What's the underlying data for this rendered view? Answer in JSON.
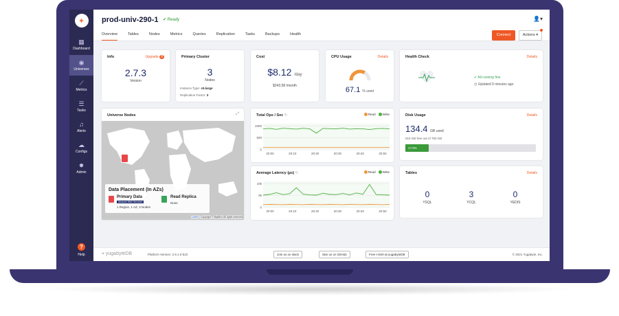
{
  "app": {
    "title": "prod-univ-290-1",
    "status": "Ready"
  },
  "sidebar": {
    "items": [
      {
        "label": "Dashboard",
        "icon": "dashboard-icon"
      },
      {
        "label": "Universes",
        "icon": "globe-icon"
      },
      {
        "label": "Metrics",
        "icon": "chart-icon"
      },
      {
        "label": "Tasks",
        "icon": "list-icon"
      },
      {
        "label": "Alerts",
        "icon": "bell-icon"
      },
      {
        "label": "Configs",
        "icon": "cloud-icon"
      },
      {
        "label": "Admin",
        "icon": "gear-icon"
      }
    ],
    "help": "Help"
  },
  "tabs": [
    "Overview",
    "Tables",
    "Nodes",
    "Metrics",
    "Queries",
    "Replication",
    "Tasks",
    "Backups",
    "Health"
  ],
  "header": {
    "connect": "Connect",
    "actions": "Actions"
  },
  "info": {
    "title": "Info",
    "upgrade": "Upgrade",
    "badge": "8",
    "version": "2.7.3",
    "version_label": "Version"
  },
  "primary": {
    "title": "Primary Cluster",
    "nodes": "3",
    "nodes_label": "Nodes",
    "instance_label": "Instance Type:",
    "instance": "c5.large",
    "rf_label": "Replication Factor:",
    "rf": "3"
  },
  "cost": {
    "title": "Cost",
    "per_day": "$8.12",
    "day_unit": "/day",
    "per_month": "$243.58 /month"
  },
  "cpu": {
    "title": "CPU Usage",
    "details": "Details",
    "value": "67.1",
    "unit": "% used",
    "fraction": 0.671
  },
  "health": {
    "title": "Health Check",
    "details": "Details",
    "status": "All running fine",
    "updated": "Updated 9 minutes ago"
  },
  "map": {
    "title": "Universe Nodes",
    "placement": "Data Placement (In AZs)",
    "primary": "Primary Data",
    "provider": "Amazon Web Services",
    "primary_detail": "1 Region, 1 AZ, 3 Nodes",
    "replica": "Read Replica",
    "replica_detail": "None",
    "credit_leaflet": "Leaflet",
    "credit": "| Copyright © MapBox All rights reserved"
  },
  "ops": {
    "title": "Total Ops / Sec",
    "legend_read": "Read",
    "legend_write": "Write",
    "y_ticks": [
      "1000",
      "500",
      "0"
    ],
    "x_ticks": [
      "20:00",
      "20:10",
      "20:20",
      "20:30",
      "20:40",
      "20:50"
    ]
  },
  "latency": {
    "title": "Average Latency (µs)",
    "legend_read": "Read",
    "legend_write": "Write",
    "y_ticks": [
      "10k",
      "5k",
      "0"
    ],
    "x_ticks": [
      "20:00",
      "20:10",
      "20:20",
      "20:30",
      "20:40",
      "20:50"
    ]
  },
  "disk": {
    "title": "Disk Usage",
    "details": "Details",
    "used": "134.4",
    "unit": "GB used",
    "free": "615 GB free out of 750 GB",
    "pct_label": "17.9%",
    "fraction": 0.179
  },
  "tables": {
    "title": "Tables",
    "details": "Details",
    "items": [
      {
        "count": "0",
        "label": "YSQL"
      },
      {
        "count": "3",
        "label": "YCQL"
      },
      {
        "count": "0",
        "label": "YEDIS"
      }
    ]
  },
  "footer": {
    "brand": "yugabyteDB",
    "version": "Platform Version: 2.9.1.0-b22",
    "slack": "Join us on  slack",
    "github": "Star us on  GitHub",
    "tshirt": "Free t-shirt at  yugabyteDB",
    "copyright": "© 2021 Yugabyte, Inc."
  },
  "colors": {
    "accent": "#ef5824",
    "read": "#f0953a",
    "write": "#4caf3f",
    "sidebar": "#2b2a52"
  },
  "chart_data": [
    {
      "type": "line",
      "title": "Total Ops / Sec",
      "series": [
        {
          "name": "Read",
          "values": [
            95,
            95,
            95,
            96,
            95,
            95,
            95,
            96,
            95,
            95,
            95,
            95,
            95,
            96,
            95,
            95,
            95,
            95,
            95,
            95
          ]
        },
        {
          "name": "Write",
          "values": [
            880,
            900,
            860,
            910,
            890,
            870,
            905,
            880,
            700,
            900,
            890,
            880,
            910,
            870,
            890,
            880,
            850,
            890,
            900,
            880
          ]
        }
      ],
      "x": [
        "20:00",
        "20:10",
        "20:20",
        "20:30",
        "20:40",
        "20:50"
      ],
      "ylim": [
        0,
        1100
      ]
    },
    {
      "type": "line",
      "title": "Average Latency (µs)",
      "series": [
        {
          "name": "Read",
          "values": [
            1200,
            1300,
            1250,
            1200,
            1300,
            1250,
            1200,
            1300,
            1250,
            1200,
            1300,
            1250,
            1200,
            1300,
            1250,
            1200,
            1300,
            1250,
            1200,
            1300
          ]
        },
        {
          "name": "Write",
          "values": [
            5200,
            5500,
            6200,
            5400,
            5800,
            8300,
            5600,
            5300,
            5200,
            6000,
            5500,
            5400,
            5900,
            5300,
            6100,
            5600,
            9700,
            5400,
            5300,
            5200
          ]
        }
      ],
      "x": [
        "20:00",
        "20:10",
        "20:20",
        "20:30",
        "20:40",
        "20:50"
      ],
      "ylim": [
        0,
        11000
      ]
    }
  ]
}
